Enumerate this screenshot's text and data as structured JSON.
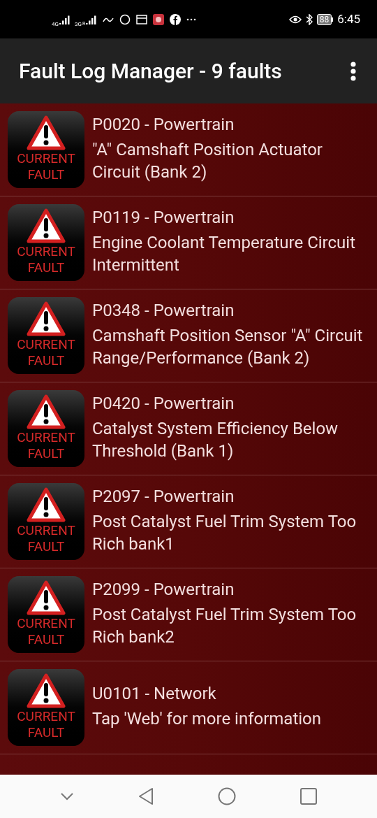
{
  "status_bar": {
    "network_1": "4G",
    "network_2": "3G",
    "roaming": "R",
    "battery": "88",
    "time": "6:45"
  },
  "app_bar": {
    "title": "Fault Log Manager - 9 faults"
  },
  "faults": [
    {
      "badge": [
        "CURRENT",
        "FAULT"
      ],
      "code": "P0020 - Powertrain",
      "description": "\"A\" Camshaft Position Actuator Circuit (Bank 2)"
    },
    {
      "badge": [
        "CURRENT",
        "FAULT"
      ],
      "code": "P0119 - Powertrain",
      "description": "Engine Coolant Temperature Circuit Intermittent"
    },
    {
      "badge": [
        "CURRENT",
        "FAULT"
      ],
      "code": "P0348 - Powertrain",
      "description": "Camshaft Position Sensor \"A\" Circuit Range/Performance (Bank 2)"
    },
    {
      "badge": [
        "CURRENT",
        "FAULT"
      ],
      "code": "P0420 - Powertrain",
      "description": "Catalyst System Efficiency Below Threshold (Bank 1)"
    },
    {
      "badge": [
        "CURRENT",
        "FAULT"
      ],
      "code": "P2097 - Powertrain",
      "description": "Post Catalyst Fuel Trim System Too Rich bank1"
    },
    {
      "badge": [
        "CURRENT",
        "FAULT"
      ],
      "code": "P2099 - Powertrain",
      "description": "Post Catalyst Fuel Trim System Too Rich bank2"
    },
    {
      "badge": [
        "CURRENT",
        "FAULT"
      ],
      "code": "U0101 - Network",
      "description": "Tap 'Web' for more information"
    }
  ]
}
